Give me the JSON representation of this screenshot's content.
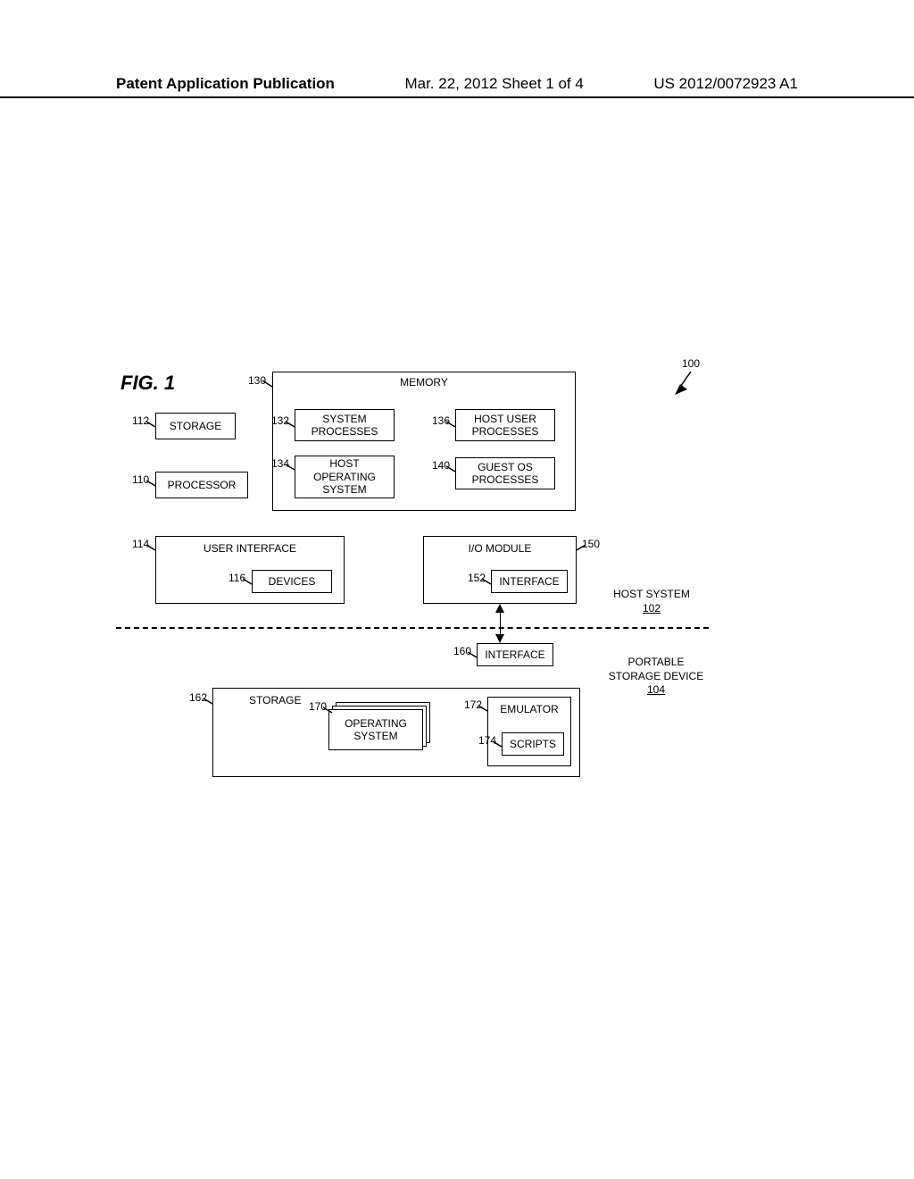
{
  "header": {
    "left": "Patent Application Publication",
    "center": "Mar. 22, 2012  Sheet 1 of 4",
    "right": "US 2012/0072923 A1"
  },
  "fig": {
    "label": "FIG. 1"
  },
  "refs": {
    "r100": "100",
    "r110": "110",
    "r112": "112",
    "r114": "114",
    "r116": "116",
    "r130": "130",
    "r132": "132",
    "r134": "134",
    "r136": "136",
    "r140": "140",
    "r150": "150",
    "r152": "152",
    "r160": "160",
    "r162": "162",
    "r170": "170",
    "r172": "172",
    "r174": "174"
  },
  "boxes": {
    "memory": "MEMORY",
    "storage": "STORAGE",
    "processor": "PROCESSOR",
    "system_processes": "SYSTEM\nPROCESSES",
    "host_os": "HOST\nOPERATING\nSYSTEM",
    "host_user_processes": "HOST USER\nPROCESSES",
    "guest_os_processes": "GUEST OS\nPROCESSES",
    "user_interface": "USER INTERFACE",
    "devices": "DEVICES",
    "io_module": "I/O MODULE",
    "interface1": "INTERFACE",
    "interface2": "INTERFACE",
    "storage2": "STORAGE",
    "operating_system": "OPERATING\nSYSTEM",
    "emulator": "EMULATOR",
    "scripts": "SCRIPTS"
  },
  "regions": {
    "host_system": "HOST SYSTEM",
    "host_system_ref": "102",
    "portable": "PORTABLE\nSTORAGE DEVICE",
    "portable_ref": "104"
  }
}
